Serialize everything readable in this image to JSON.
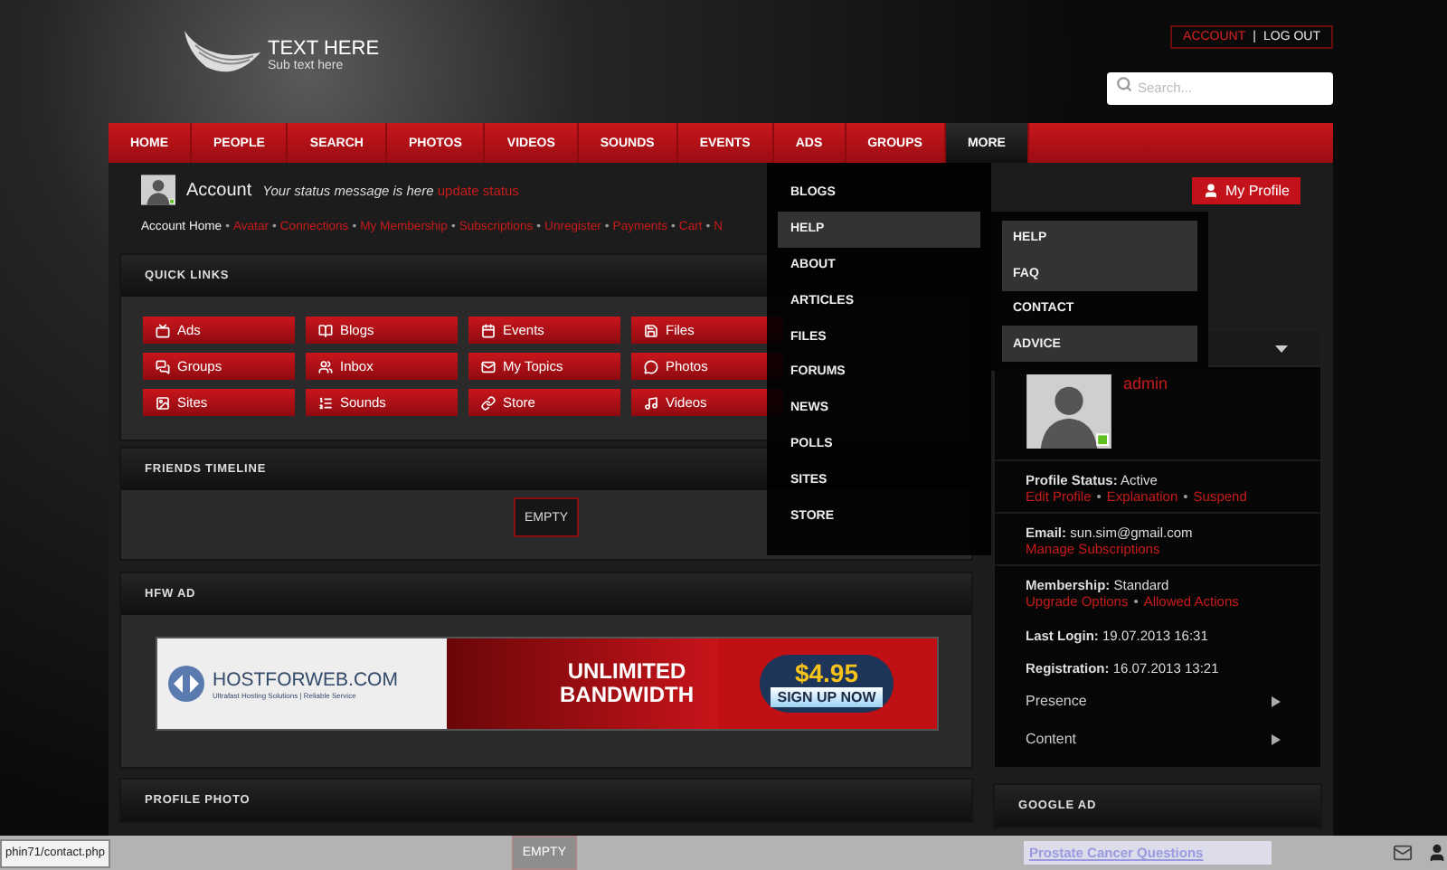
{
  "logo": {
    "title": "TEXT HERE",
    "subtitle": "Sub text here"
  },
  "account_links": [
    {
      "label": "ACCOUNT",
      "selected": true
    },
    {
      "label": "LOG OUT",
      "selected": false
    }
  ],
  "account_links_separator": "|",
  "search": {
    "placeholder": "Search..."
  },
  "nav": [
    {
      "label": "HOME",
      "selected": false
    },
    {
      "label": "PEOPLE",
      "selected": false
    },
    {
      "label": "SEARCH",
      "selected": false
    },
    {
      "label": "PHOTOS",
      "selected": false
    },
    {
      "label": "VIDEOS",
      "selected": false
    },
    {
      "label": "SOUNDS",
      "selected": false
    },
    {
      "label": "EVENTS",
      "selected": false
    },
    {
      "label": "ADS",
      "selected": false
    },
    {
      "label": "GROUPS",
      "selected": false
    },
    {
      "label": "MORE",
      "selected": true
    }
  ],
  "more_menu": [
    {
      "label": "BLOGS",
      "selected": false
    },
    {
      "label": "HELP",
      "selected": true,
      "children": [
        {
          "label": "HELP",
          "selected": false
        },
        {
          "label": "FAQ",
          "selected": false
        },
        {
          "label": "CONTACT",
          "selected": true
        },
        {
          "label": "ADVICE",
          "selected": false
        }
      ]
    },
    {
      "label": "ABOUT",
      "selected": false
    },
    {
      "label": "ARTICLES",
      "selected": false
    },
    {
      "label": "FILES",
      "selected": false
    },
    {
      "label": "FORUMS",
      "selected": false
    },
    {
      "label": "NEWS",
      "selected": false
    },
    {
      "label": "POLLS",
      "selected": false
    },
    {
      "label": "SITES",
      "selected": false
    },
    {
      "label": "STORE",
      "selected": false
    }
  ],
  "account": {
    "title": "Account",
    "online": true,
    "status": "Your status message is here",
    "status_link": "update status",
    "profile_button": "My Profile",
    "separator": "•",
    "links": [
      {
        "label": "Account Home",
        "selected": true
      },
      {
        "label": "Avatar",
        "selected": false
      },
      {
        "label": "Connections",
        "selected": false
      },
      {
        "label": "My Membership",
        "selected": false
      },
      {
        "label": "Subscriptions",
        "selected": false
      },
      {
        "label": "Unregister",
        "selected": false
      },
      {
        "label": "Payments",
        "selected": false
      },
      {
        "label": "Cart",
        "selected": false
      },
      {
        "label": "N",
        "selected": false
      }
    ]
  },
  "quick_links": {
    "title": "QUICK LINKS",
    "items": [
      {
        "label": "Ads"
      },
      {
        "label": "Blogs"
      },
      {
        "label": "Events"
      },
      {
        "label": "Files"
      },
      {
        "label": "Groups"
      },
      {
        "label": "Inbox"
      },
      {
        "label": "My Topics"
      },
      {
        "label": "Photos"
      },
      {
        "label": "Sites"
      },
      {
        "label": "Sounds"
      },
      {
        "label": "Store"
      },
      {
        "label": "Videos"
      }
    ]
  },
  "friends_timeline": {
    "title": "FRIENDS TIMELINE",
    "empty": "EMPTY"
  },
  "ad_panel": {
    "title": "HFW AD",
    "banner": {
      "brand": "HOSTFORWEB.COM",
      "tagline": "Ultrafast Hosting Solutions | Reliable Service",
      "headline": "UNLIMITED BANDWIDTH",
      "price": "$4.95",
      "cta": "SIGN UP NOW"
    }
  },
  "profile_photo": {
    "title": "PROFILE PHOTO",
    "empty": "EMPTY"
  },
  "profile_card": {
    "name": "admin",
    "online": true,
    "separator": "•",
    "fields": [
      {
        "label": "Profile Status:",
        "value": "Active",
        "links": [
          "Edit Profile",
          "Explanation",
          "Suspend"
        ]
      },
      {
        "label": "Email:",
        "value": "sun.sim@gmail.com",
        "links": [
          "Manage Subscriptions"
        ]
      },
      {
        "label": "Membership:",
        "value": "Standard",
        "links": [
          "Upgrade Options",
          "Allowed Actions"
        ]
      },
      {
        "label": "Last Login:",
        "value": "19.07.2013 16:31"
      },
      {
        "label": "Registration:",
        "value": "16.07.2013 13:21"
      }
    ],
    "sections": [
      {
        "label": "Presence",
        "expanded": false
      },
      {
        "label": "Content",
        "expanded": false
      }
    ]
  },
  "google_ad": {
    "title": "GOOGLE AD",
    "link": "Prostate Cancer Questions"
  },
  "status_bar": {
    "url": "phin71/contact.php"
  }
}
